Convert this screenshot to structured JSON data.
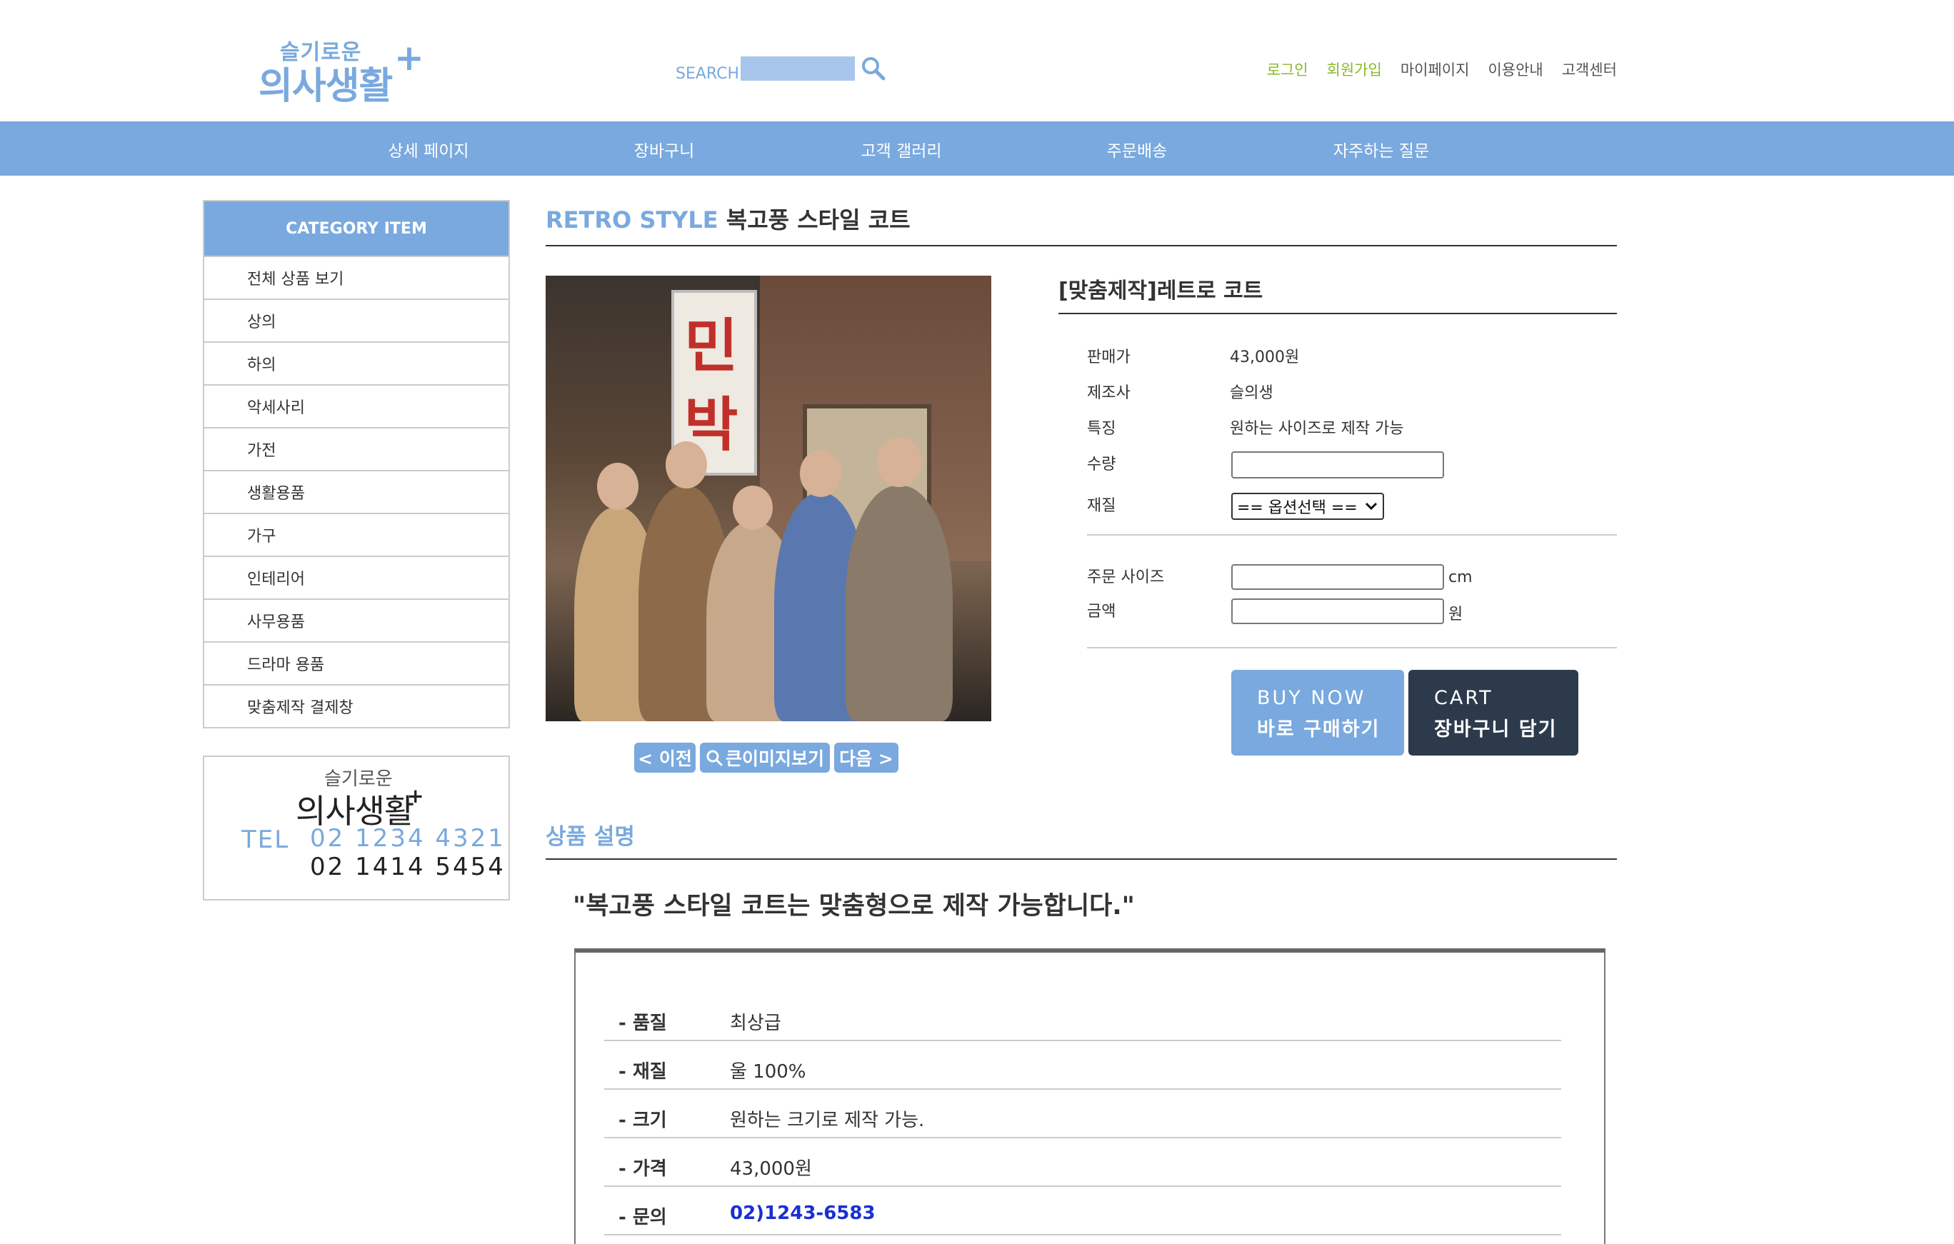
{
  "header": {
    "logo_small": "슬기로운",
    "logo_big": "의사생활",
    "logo_plus": "+",
    "search_label": "SEARCH",
    "search_value": "",
    "top_links": [
      "로그인",
      "회원가입",
      "마이페이지",
      "이용안내",
      "고객센터"
    ]
  },
  "mainnav": [
    "상세 페이지",
    "장바구니",
    "고객 갤러리",
    "주문배송",
    "자주하는 질문"
  ],
  "sidebar": {
    "category_title": "CATEGORY ITEM",
    "items": [
      "전체 상품 보기",
      "상의",
      "하의",
      "악세사리",
      "가전",
      "생활용품",
      "가구",
      "인테리어",
      "사무용품",
      "드라마 용품",
      "맞춤제작 결제창"
    ],
    "contact": {
      "logo_small": "슬기로운",
      "logo_big": "의사생활",
      "logo_plus": "+",
      "tel_label": "TEL",
      "phone1": "02 1234 4321",
      "phone2": "02 1414 5454"
    }
  },
  "content": {
    "title_accent": "RETRO STYLE",
    "title": "복고풍 스타일 코트",
    "image_banner": [
      "민",
      "박"
    ],
    "photo_buttons": [
      "< 이전",
      "큰이미지보기",
      "다음 >"
    ],
    "product_name": "[맞춤제작]레트로 코트",
    "specs": [
      {
        "label": "판매가",
        "value": "43,000원"
      },
      {
        "label": "제조사",
        "value": "슬의생"
      },
      {
        "label": "특징",
        "value": "원하는 사이즈로 제작 가능"
      },
      {
        "label": "수량",
        "value": ""
      },
      {
        "label": "재질",
        "value": ""
      }
    ],
    "material_select": "== 옵션선택 ==",
    "order_size_label": "주문 사이즈",
    "order_size_unit": "cm",
    "amount_label": "금액",
    "amount_unit": "원",
    "buy_now": {
      "line1": "BUY NOW",
      "line2": "바로 구매하기"
    },
    "cart": {
      "line1": "CART",
      "line2": "장바구니 담기"
    },
    "section_title": "상품 설명",
    "quote": "\"복고풍 스타일 코트는 맞춤형으로 제작 가능합니다.\"",
    "details": [
      {
        "key": "- 품질",
        "value": "최상급"
      },
      {
        "key": "- 재질",
        "value": "울 100%"
      },
      {
        "key": "- 크기",
        "value": "원하는 크기로 제작 가능."
      },
      {
        "key": "- 가격",
        "value": "43,000원"
      },
      {
        "key": "- 문의",
        "value": "02)1243-6583"
      }
    ]
  },
  "colors": {
    "accent": "#79a9de",
    "green": "#8ab828",
    "dark_button": "#2c3a4c",
    "link": "#1a2fd1"
  }
}
